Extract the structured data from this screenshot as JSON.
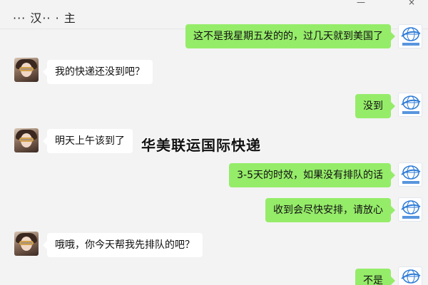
{
  "window": {
    "title": "··· 汉·· · 主"
  },
  "brand": {
    "name_on_logo": "华美联运",
    "logo_color": "#2e7bd6"
  },
  "watermark": "华美联运国际快递",
  "messages": [
    {
      "side": "right",
      "text": "这不是我星期五发的的，过几天就到美国了"
    },
    {
      "side": "left",
      "text": "我的快递还没到吧？"
    },
    {
      "side": "right",
      "text": "没到"
    },
    {
      "side": "left",
      "text": "明天上午该到了"
    },
    {
      "side": "right",
      "text": "3-5天的时效，如果没有排队的话"
    },
    {
      "side": "right",
      "text": "收到会尽快安排，请放心"
    },
    {
      "side": "left",
      "text": "哦哦，你今天帮我先排队的吧？"
    },
    {
      "side": "right",
      "text": "不是"
    }
  ],
  "colors": {
    "chat_background": "#f3f3f3",
    "outgoing_bubble": "#95ec69",
    "incoming_bubble": "#ffffff"
  }
}
